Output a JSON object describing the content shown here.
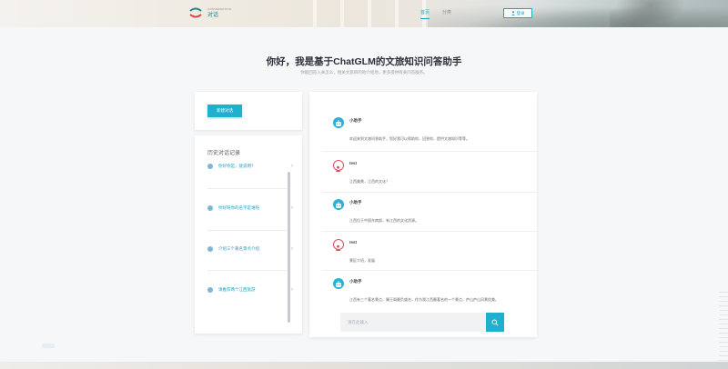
{
  "header": {
    "logo_sub": "CONVERSATION",
    "logo_name": "对话",
    "nav": [
      {
        "label": "首页",
        "active": true
      },
      {
        "label": "分类",
        "active": false
      }
    ],
    "login_label": "登录"
  },
  "hero": {
    "title": "你好，我是基于ChatGLM的文旅知识问答助手",
    "subtitle": "你能回答入关怎么，相关文旅目的地介绍地，更多提供有关问答服务。"
  },
  "sidebar": {
    "new_chat_label": "新建对话",
    "history_title": "历史对话记录",
    "items": [
      {
        "label": "你好你是，能说明？"
      },
      {
        "label": "你好呀你的名字是谁呀"
      },
      {
        "label": "介绍三个著名景点介绍"
      },
      {
        "label": "请推荐两个江西旅游"
      }
    ]
  },
  "chat": {
    "messages": [
      {
        "role": "bot",
        "name": "小助手",
        "text": "欢迎来到文旅问答助手，您好我可以帮助你，回答你，提供文旅知识等等。"
      },
      {
        "role": "user",
        "name": "test",
        "text": "江西美景，江西的文化？"
      },
      {
        "role": "bot",
        "name": "小助手",
        "text": "江西位于中国东南部，有江西的文化资源。"
      },
      {
        "role": "user",
        "name": "test",
        "text": "景区介绍，发展"
      },
      {
        "role": "bot",
        "name": "小助手",
        "text": "江西有三个著名景点，滕王阁最负盛名，作为我江西最著名的一个景点，庐山庐山风景优美。"
      }
    ],
    "input_placeholder": "请在此输入"
  },
  "colors": {
    "accent": "#1fb0cd",
    "user_avatar": "#e04b5e",
    "link": "#1f9fc2"
  }
}
